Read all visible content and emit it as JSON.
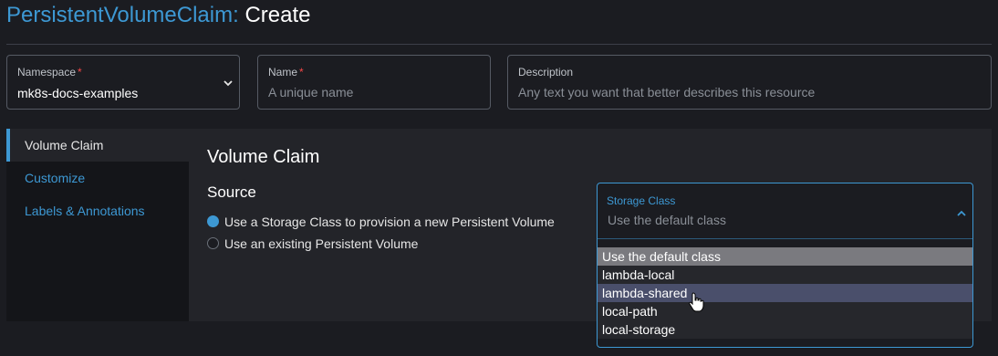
{
  "header": {
    "resource": "PersistentVolumeClaim:",
    "action": "Create"
  },
  "fields": {
    "namespace": {
      "label": "Namespace",
      "required": "*",
      "value": "mk8s-docs-examples"
    },
    "name": {
      "label": "Name",
      "required": "*",
      "placeholder": "A unique name"
    },
    "description": {
      "label": "Description",
      "placeholder": "Any text you want that better describes this resource"
    }
  },
  "sidebar": {
    "items": [
      {
        "label": "Volume Claim",
        "active": true
      },
      {
        "label": "Customize"
      },
      {
        "label": "Labels & Annotations"
      }
    ]
  },
  "main": {
    "title": "Volume Claim",
    "source_heading": "Source",
    "source_options": [
      {
        "label": "Use a Storage Class to provision a new Persistent Volume",
        "selected": true
      },
      {
        "label": "Use an existing Persistent Volume",
        "selected": false
      }
    ]
  },
  "storage_class": {
    "label": "Storage Class",
    "placeholder": "Use the default class",
    "options": [
      "Use the default class",
      "lambda-local",
      "lambda-shared",
      "local-path",
      "local-storage"
    ],
    "selected_option": "Use the default class",
    "hovered_option": "lambda-shared"
  },
  "colors": {
    "accent": "#3d98d3",
    "background": "#1b1c21",
    "panel": "#232429",
    "required": "#f64747"
  },
  "icons": {
    "select_chevron": "chevron-down-icon",
    "open_chevron": "chevron-up-icon",
    "cursor": "hand-pointer-icon"
  }
}
